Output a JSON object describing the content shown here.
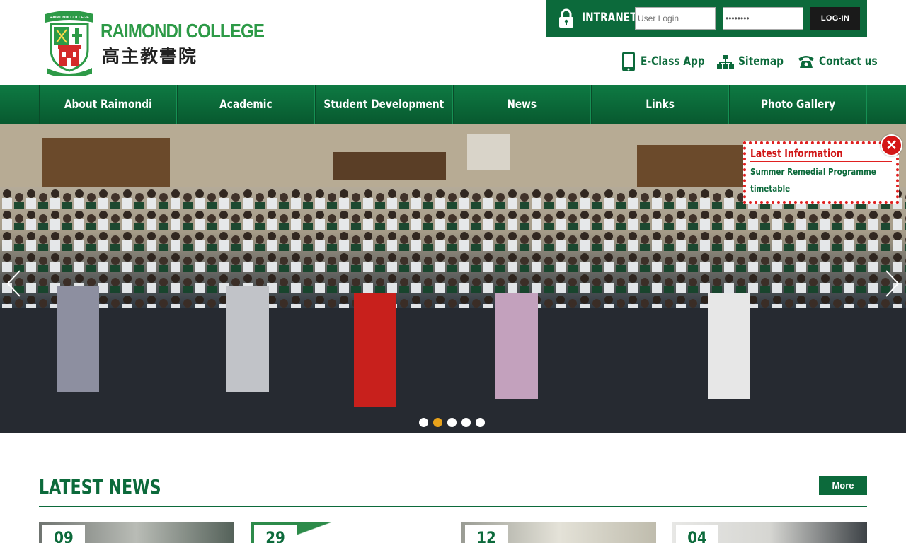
{
  "header": {
    "logo_en": "RAIMONDI COLLEGE",
    "logo_zh": "高主教書院",
    "crest_text": "RAIMONDI COLLEGE",
    "intranet_label": "INTRANET:",
    "user_placeholder": "User Login",
    "password_value": "password",
    "login_label": "LOG-IN",
    "links": [
      {
        "label": "E-Class App",
        "icon": "phone-icon"
      },
      {
        "label": "Sitemap",
        "icon": "sitemap-icon"
      },
      {
        "label": "Contact us",
        "icon": "telephone-icon"
      }
    ]
  },
  "nav": {
    "items": [
      "About Raimondi",
      "Academic",
      "Student Development",
      "News",
      "Links",
      "Photo Gallery"
    ]
  },
  "hero": {
    "slide_count": 5,
    "active_slide": 2,
    "latest_info": {
      "title": "Latest Information",
      "items": [
        "Summer Remedial Programme timetable"
      ]
    }
  },
  "news": {
    "title": "LATEST NEWS",
    "more_label": "More",
    "cards": [
      {
        "date": "09"
      },
      {
        "date": "29"
      },
      {
        "date": "12"
      },
      {
        "date": "04"
      }
    ]
  },
  "colors": {
    "brand_green": "#0c6a3b",
    "logo_green": "#2d9a47",
    "alert_red": "#d01515",
    "dot_active": "#e8a21b"
  }
}
